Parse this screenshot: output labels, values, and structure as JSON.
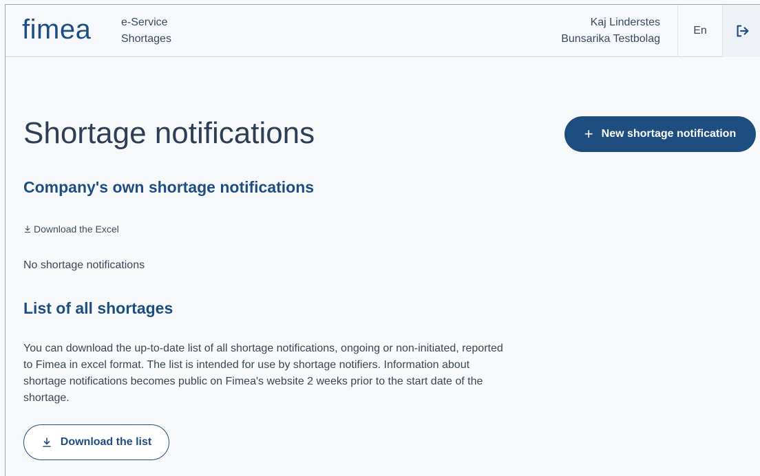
{
  "header": {
    "logo": "fimea",
    "service_line1": "e-Service",
    "service_line2": "Shortages",
    "user_name": "Kaj Linderstes",
    "company": "Bunsarika Testbolag",
    "language": "En"
  },
  "main": {
    "page_title": "Shortage notifications",
    "new_button_label": "New shortage notification",
    "company_section_title": "Company's own shortage notifications",
    "download_excel_label": "Download the Excel",
    "empty_message": "No shortage notifications",
    "all_section_title": "List of all shortages",
    "description": "You can download the up-to-date list of all shortage notifications, ongoing or non-initiated, reported to Fimea in excel format. The list is intended for use by shortage notifiers. Information about shortage notifications becomes public on Fimea's website 2 weeks prior to the start date of the shortage.",
    "download_list_label": "Download the list"
  },
  "colors": {
    "brand": "#1d4e82",
    "background": "#f8f9fb"
  },
  "icons": {
    "plus": "plus-icon",
    "download": "download-icon",
    "logout": "logout-icon"
  }
}
